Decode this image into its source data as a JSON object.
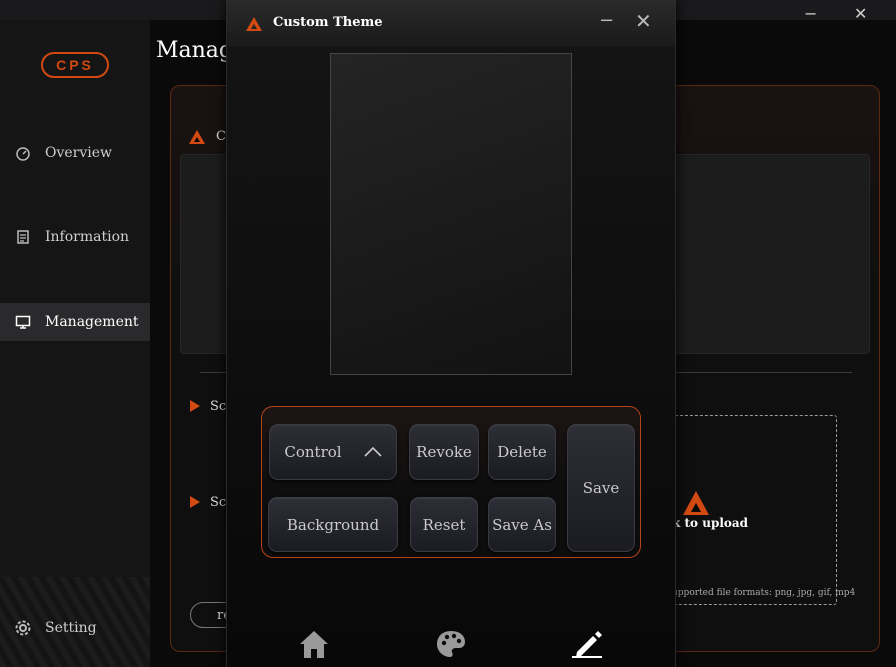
{
  "main_window": {
    "title": "Manage",
    "minimize_glyph": "−",
    "close_glyph": "✕"
  },
  "sidebar": {
    "logo_text": "CPS",
    "items": [
      {
        "label": "Overview",
        "icon": "dashboard-icon"
      },
      {
        "label": "Information",
        "icon": "document-icon"
      },
      {
        "label": "Management",
        "icon": "monitor-icon",
        "active": true
      },
      {
        "label": "Setting",
        "icon": "gear-icon"
      }
    ]
  },
  "content": {
    "section_header_partial": "C",
    "row1_partial": "Sc",
    "row2_partial": "Sc",
    "pill_button_partial": "re",
    "upload_label": "k to upload",
    "formats": "upported file formats: png, jpg, gif, mp4"
  },
  "dialog": {
    "title": "Custom Theme",
    "minimize_glyph": "−",
    "close_glyph": "✕",
    "buttons": {
      "control": "Control",
      "revoke": "Revoke",
      "delete": "Delete",
      "save": "Save",
      "background": "Background",
      "reset": "Reset",
      "save_as": "Save As"
    },
    "tabs": [
      {
        "icon": "home-icon"
      },
      {
        "icon": "palette-icon"
      },
      {
        "icon": "pencil-icon",
        "active": true
      }
    ]
  },
  "colors": {
    "accent": "#d24a12",
    "panel_border": "#b5441a",
    "key_bg": "#24242b"
  }
}
